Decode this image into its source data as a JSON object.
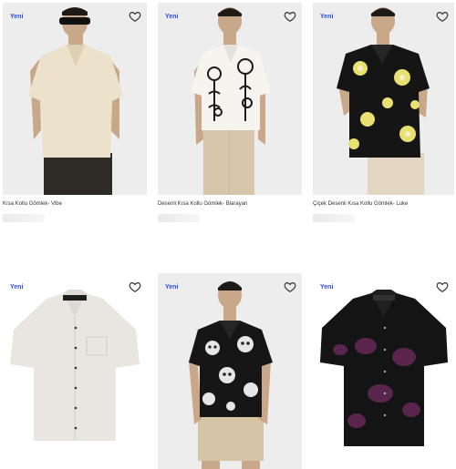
{
  "products": [
    {
      "badge": "Yeni",
      "title": "Kısa Kollu Gömlek- Vibe",
      "icon": "heart-icon"
    },
    {
      "badge": "Yeni",
      "title": "Desenli Kısa Kollu Gömlek- Blarayan",
      "icon": "heart-icon"
    },
    {
      "badge": "Yeni",
      "title": "Çiçek Desenli Kısa Kollu Gömlek- Luke",
      "icon": "heart-icon"
    },
    {
      "badge": "Yeni",
      "title": "",
      "icon": "heart-icon"
    },
    {
      "badge": "Yeni",
      "title": "",
      "icon": "heart-icon"
    },
    {
      "badge": "Yeni",
      "title": "",
      "icon": "heart-icon"
    }
  ],
  "colors": {
    "badge": "#2f4fd6",
    "image_bg": "#ececec"
  }
}
